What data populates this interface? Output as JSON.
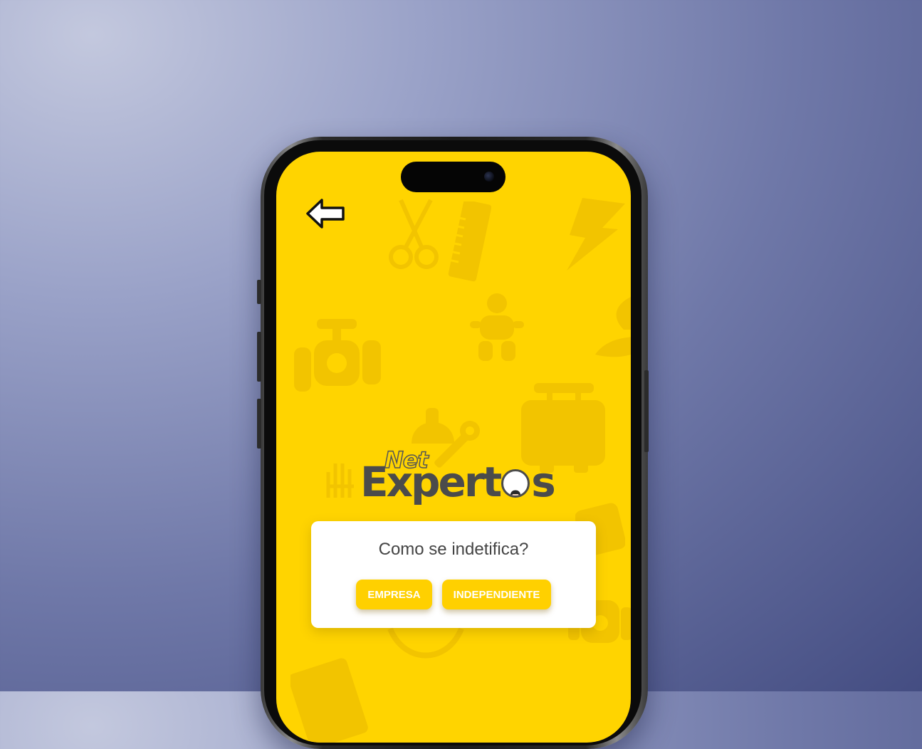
{
  "app": {
    "brand": {
      "prefix": "Net",
      "name_start": "Expert",
      "name_end": "s"
    },
    "header": {
      "back_icon": "arrow-left-icon"
    },
    "dialog": {
      "title": "Como se indetifica?",
      "buttons": [
        {
          "label": "EMPRESA"
        },
        {
          "label": "INDEPENDIENTE"
        }
      ]
    },
    "colors": {
      "screen_background": "#ffd400",
      "button_background": "#ffd000",
      "button_text": "#ffffff",
      "logo_text": "#4b4b4b"
    },
    "background_icons": [
      "scissors-icon",
      "comb-icon",
      "lightning-icon",
      "baby-icon",
      "valve-icon",
      "toolbox-icon",
      "hardhat-wrench-icon",
      "glove-icon",
      "leaf-icon"
    ]
  }
}
